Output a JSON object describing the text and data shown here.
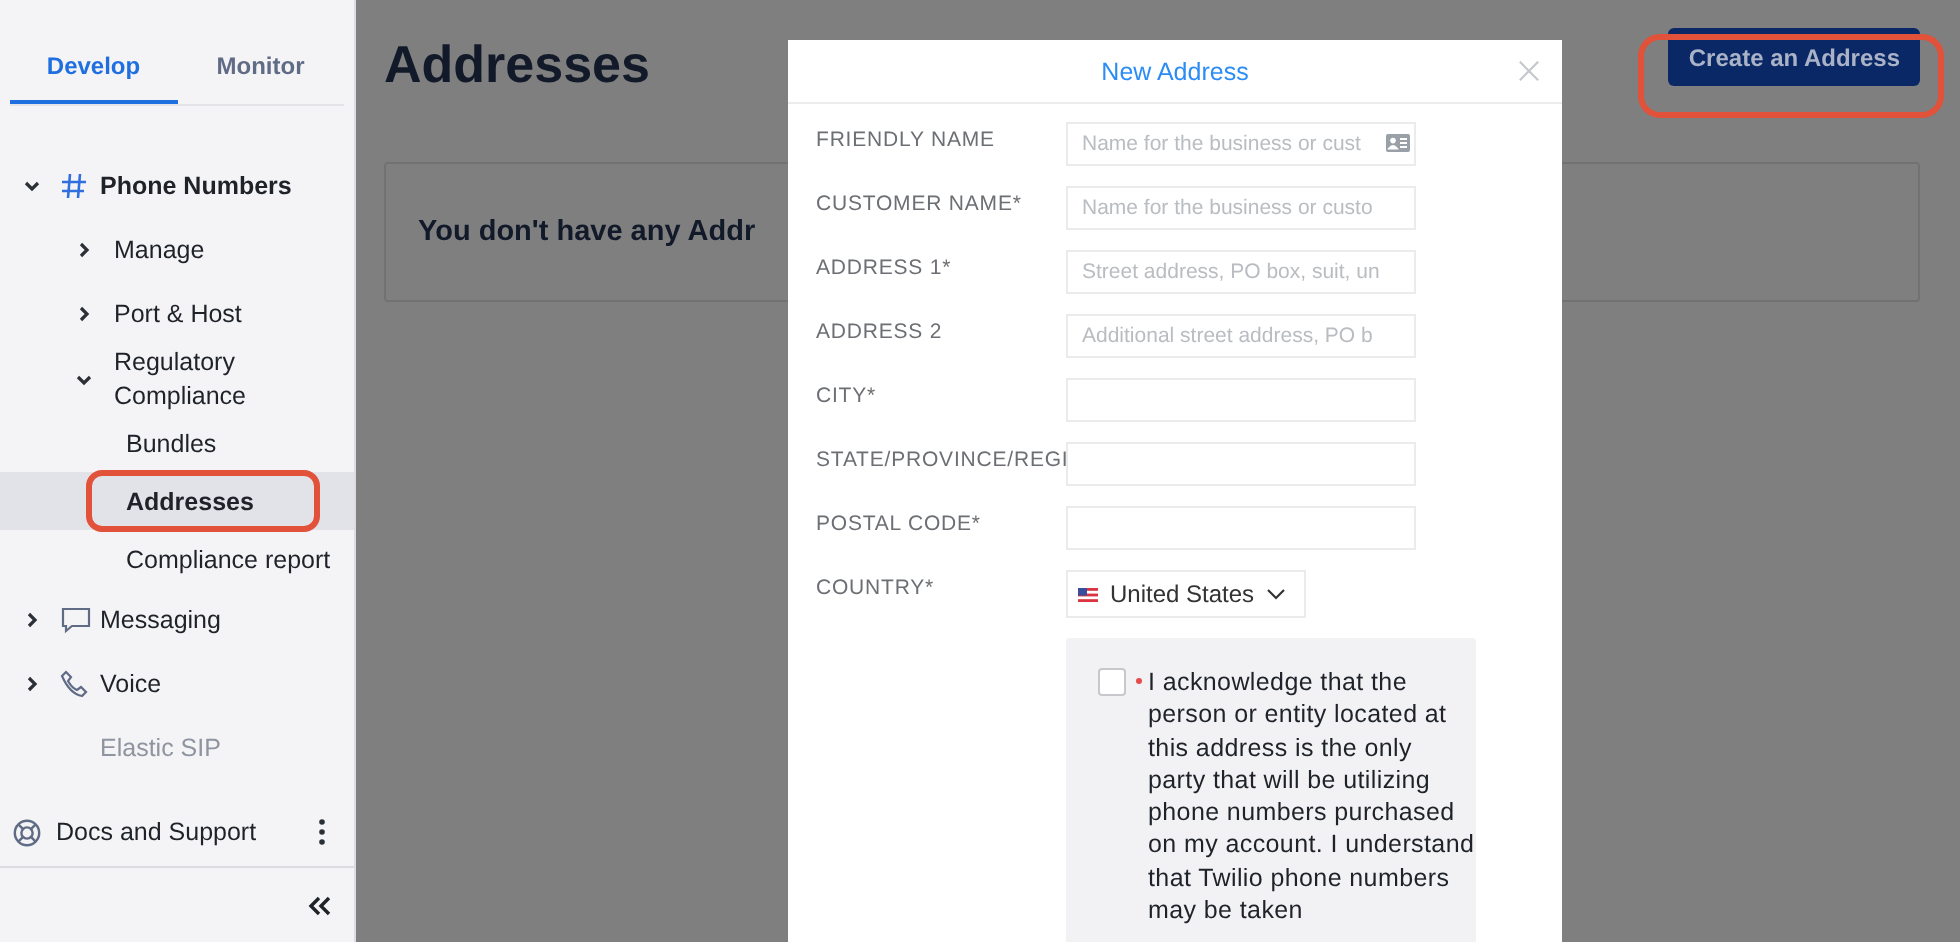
{
  "sidebar": {
    "tabs": [
      {
        "label": "Develop",
        "selected": true
      },
      {
        "label": "Monitor",
        "selected": false
      }
    ],
    "tree": [
      {
        "label": "Phone Numbers",
        "kind": "numbers",
        "expanded": true,
        "selected": false,
        "children": [
          {
            "label": "Manage",
            "expanded": false,
            "selected": false
          },
          {
            "label": "Port & Host",
            "expanded": false,
            "selected": false
          },
          {
            "label": "Regulatory Compliance",
            "expanded": true,
            "selected": false,
            "children": [
              {
                "label": "Bundles",
                "selected": false,
                "highlighted": false
              },
              {
                "label": "Addresses",
                "selected": true,
                "highlighted": true
              },
              {
                "label": "Compliance report",
                "selected": false,
                "highlighted": false
              }
            ]
          }
        ]
      },
      {
        "label": "Messaging",
        "kind": "messaging",
        "expanded": false,
        "selected": false
      },
      {
        "label": "Voice",
        "kind": "voice",
        "expanded": false,
        "selected": false
      },
      {
        "label": "Elastic SIP",
        "kind": "sip",
        "expanded": false,
        "selected": false,
        "faded": true
      }
    ],
    "footer": {
      "label": "Docs and Support"
    }
  },
  "page": {
    "title": "Addresses",
    "empty_message": "You don't have any Addr",
    "create_button": {
      "label": "Create an Address",
      "highlighted": true
    }
  },
  "dialog": {
    "title": "New Address",
    "fields": [
      {
        "kind": "text",
        "label": "FRIENDLY NAME",
        "placeholder": "Name for the business or cust",
        "autofill_icon": true
      },
      {
        "kind": "text",
        "label": "CUSTOMER NAME*",
        "placeholder": "Name for the business or custo"
      },
      {
        "kind": "text",
        "label": "ADDRESS 1*",
        "placeholder": "Street address, PO box, suit, un"
      },
      {
        "kind": "text",
        "label": "ADDRESS 2",
        "placeholder": "Additional street address, PO b"
      },
      {
        "kind": "text",
        "label": "CITY*"
      },
      {
        "kind": "text",
        "label": "STATE/PROVINCE/REGI"
      },
      {
        "kind": "text",
        "label": "POSTAL CODE*"
      },
      {
        "kind": "select",
        "label": "COUNTRY*",
        "value": "United States"
      }
    ],
    "acknowledgement": {
      "checked": false,
      "required": true,
      "text": "I acknowledge that the person or entity located at this address is the only party that will be utilizing phone numbers purchased on my account. I understand that Twilio phone numbers may be taken"
    }
  }
}
